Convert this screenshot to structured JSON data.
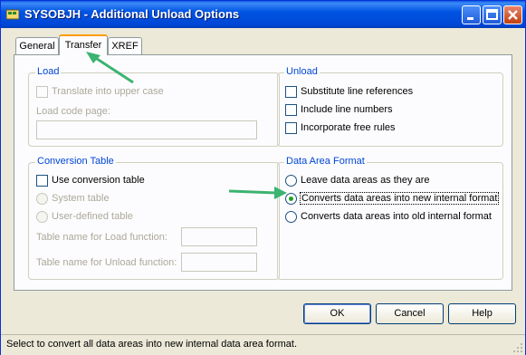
{
  "window": {
    "title": "SYSOBJH - Additional Unload Options"
  },
  "tabs": [
    {
      "label": "General"
    },
    {
      "label": "Transfer"
    },
    {
      "label": "XREF"
    }
  ],
  "load": {
    "title": "Load",
    "translate_upper": "Translate into upper case",
    "code_page_label": "Load code page:",
    "code_page_value": ""
  },
  "unload": {
    "title": "Unload",
    "substitute": "Substitute line references",
    "include_lines": "Include line numbers",
    "incorporate_free": "Incorporate free rules"
  },
  "conversion": {
    "title": "Conversion Table",
    "use_table": "Use conversion table",
    "system_table": "System table",
    "user_table": "User-defined table",
    "load_fn_label": "Table name for Load function:",
    "unload_fn_label": "Table name for Unload function:",
    "load_fn_value": "",
    "unload_fn_value": ""
  },
  "data_area": {
    "title": "Data Area Format",
    "options": [
      {
        "label": "Leave data areas as they are",
        "checked": false
      },
      {
        "label": "Converts data areas into new internal format",
        "checked": true
      },
      {
        "label": "Converts data areas into old internal format",
        "checked": false
      }
    ]
  },
  "buttons": {
    "ok": "OK",
    "cancel": "Cancel",
    "help": "Help"
  },
  "status": "Select to convert all data areas into new internal data area format.",
  "colors": {
    "accent_arrow": "#3cb371",
    "title_bar": "#0054e3",
    "tab_highlight": "#ff9c00"
  }
}
